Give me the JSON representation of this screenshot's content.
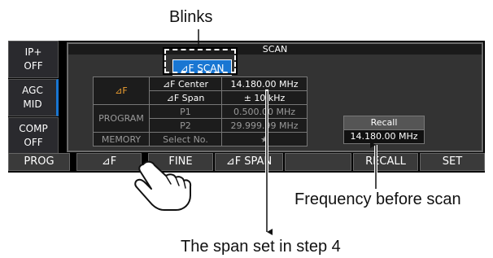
{
  "annotations": {
    "blinks": "Blinks",
    "freq_before": "Frequency before scan",
    "span_step": "The span set in step 4"
  },
  "side": [
    {
      "line1": "IP+",
      "line2": "OFF"
    },
    {
      "line1": "AGC",
      "line2": "MID"
    },
    {
      "line1": "COMP",
      "line2": "OFF"
    }
  ],
  "scan": {
    "title": "SCAN",
    "mode_button": "⊿F SCAN",
    "rows": {
      "df_cat": "⊿F",
      "center_label": "⊿F Center",
      "center_value": "14.180.00  MHz",
      "span_label": "⊿F Span",
      "span_value": "±  10  kHz",
      "program_cat": "PROGRAM",
      "p1_label": "P1",
      "p1_value": "0.500.00  MHz",
      "p2_label": "P2",
      "p2_value": "29.999.99  MHz",
      "memory_cat": "MEMORY",
      "memory_label": "Select No.",
      "memory_value": "★"
    },
    "recall": {
      "title": "Recall",
      "value": "14.180.00  MHz"
    }
  },
  "softkeys": [
    "PROG",
    "⊿F",
    "FINE",
    "⊿F SPAN",
    "",
    "RECALL",
    "SET"
  ]
}
